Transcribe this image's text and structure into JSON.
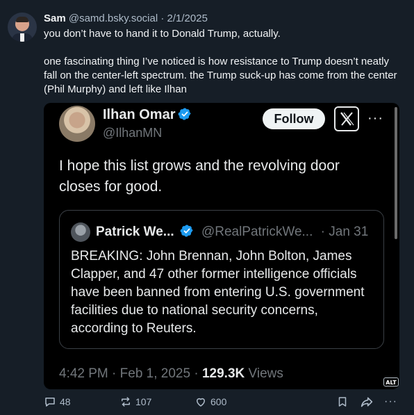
{
  "post": {
    "author_name": "Sam",
    "author_handle": "@samd.bsky.social",
    "separator": "·",
    "date": "2/1/2025",
    "paragraphs": [
      "you don’t have to hand it to Donald Trump, actually.",
      "one fascinating thing I’ve noticed is how resistance to Trump doesn’t neatly fall on the center-left spectrum. the Trump suck-up has come from the center (Phil Murphy) and left like Ilhan"
    ]
  },
  "embed": {
    "name": "Ilhan Omar",
    "handle": "@IlhanMN",
    "follow_label": "Follow",
    "more_label": "···",
    "text": "I hope this list grows and the revolving door closes for good.",
    "quote": {
      "name": "Patrick We...",
      "handle": "@RealPatrickWe...",
      "time": "· Jan 31",
      "text": "BREAKING: John Brennan, John Bolton, James Clapper, and 47 other former intelligence officials have been banned from entering U.S. government facilities due to national security concerns, according to Reuters."
    },
    "meta": {
      "time": "4:42 PM",
      "sep1": " · ",
      "date": "Feb 1, 2025",
      "sep2": " · ",
      "views_count": "129.3K",
      "views_label": " Views"
    },
    "alt_badge": "ALT"
  },
  "actions": {
    "reply_count": "48",
    "repost_count": "107",
    "like_count": "600",
    "more_label": "···"
  },
  "colors": {
    "background": "#161e27",
    "verified": "#1d9bf0",
    "muted": "#aebbc9"
  },
  "icons": [
    "reply-icon",
    "repost-icon",
    "like-icon",
    "bookmark-icon",
    "share-icon",
    "more-icon",
    "verified-icon",
    "x-logo-icon"
  ]
}
